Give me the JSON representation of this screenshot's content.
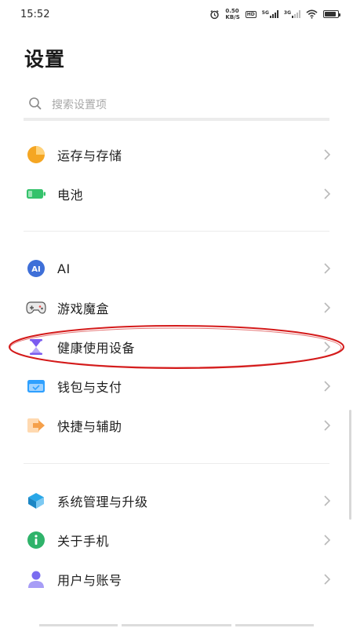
{
  "status_bar": {
    "time": "15:52",
    "net_speed_value": "0.50",
    "net_speed_unit": "KB/S",
    "hd_label": "HD",
    "sim1_label": "5G",
    "sim2_label": "3G"
  },
  "header": {
    "title": "设置"
  },
  "search": {
    "placeholder": "搜索设置项"
  },
  "colors": {
    "storage": "#f5a623",
    "battery": "#34c26b",
    "ai": "#3e6fd8",
    "game": "#555555",
    "health": "#7b5cf0",
    "wallet": "#2ea0ff",
    "shortcut": "#f5a04a",
    "system": "#29a7e8",
    "about": "#2fb36a",
    "account": "#7a6cf0",
    "highlight": "#d41a1a"
  },
  "settings": {
    "storage": {
      "label": "运存与存储",
      "icon": "pie-chart-icon"
    },
    "battery": {
      "label": "电池",
      "icon": "battery-icon"
    },
    "ai": {
      "label": "AI",
      "icon": "ai-icon",
      "badge": "AI"
    },
    "game": {
      "label": "游戏魔盒",
      "icon": "gamepad-icon"
    },
    "health": {
      "label": "健康使用设备",
      "icon": "hourglass-icon"
    },
    "wallet": {
      "label": "钱包与支付",
      "icon": "wallet-icon"
    },
    "shortcut": {
      "label": "快捷与辅助",
      "icon": "shortcut-arrow-icon"
    },
    "system": {
      "label": "系统管理与升级",
      "icon": "layers-icon"
    },
    "about": {
      "label": "关于手机",
      "icon": "info-icon"
    },
    "account": {
      "label": "用户与账号",
      "icon": "user-icon"
    }
  }
}
